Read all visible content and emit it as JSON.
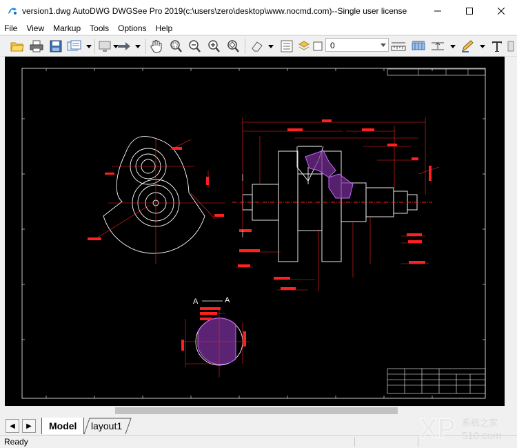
{
  "window": {
    "title": "version1.dwg AutoDWG DWGSee Pro 2019(c:\\users\\zero\\desktop\\www.nocmd.com)--Single user license",
    "controls": [
      "minimize-icon",
      "maximize-icon",
      "close-icon"
    ]
  },
  "menu": [
    "File",
    "View",
    "Markup",
    "Tools",
    "Options",
    "Help"
  ],
  "toolbar": {
    "icons": [
      "open-folder-icon",
      "print-icon",
      "save-icon",
      "export-icon",
      "monitor-icon",
      "arrow-right-icon",
      "pan-hand-icon",
      "zoom-window-icon",
      "zoom-out-icon",
      "zoom-in-icon",
      "zoom-extents-icon",
      "eraser-icon",
      "layer-icon",
      "measure-icon",
      "dimension-icon",
      "distance-icon",
      "pen-icon",
      "text-icon"
    ],
    "layer_value": "0"
  },
  "drawing": {
    "section_label_left": "A",
    "section_label_right": "A"
  },
  "tabs": [
    {
      "label": "Model",
      "active": true
    },
    {
      "label": "layout1",
      "active": false
    }
  ],
  "status": {
    "text": "Ready"
  },
  "watermark": {
    "brand": "系统之家",
    "site": "510.com"
  },
  "colors": {
    "cad_red": "#ff2020",
    "cad_white": "#ffffff",
    "cad_background": "#000000",
    "hatch_magenta": "#cc66ff"
  }
}
